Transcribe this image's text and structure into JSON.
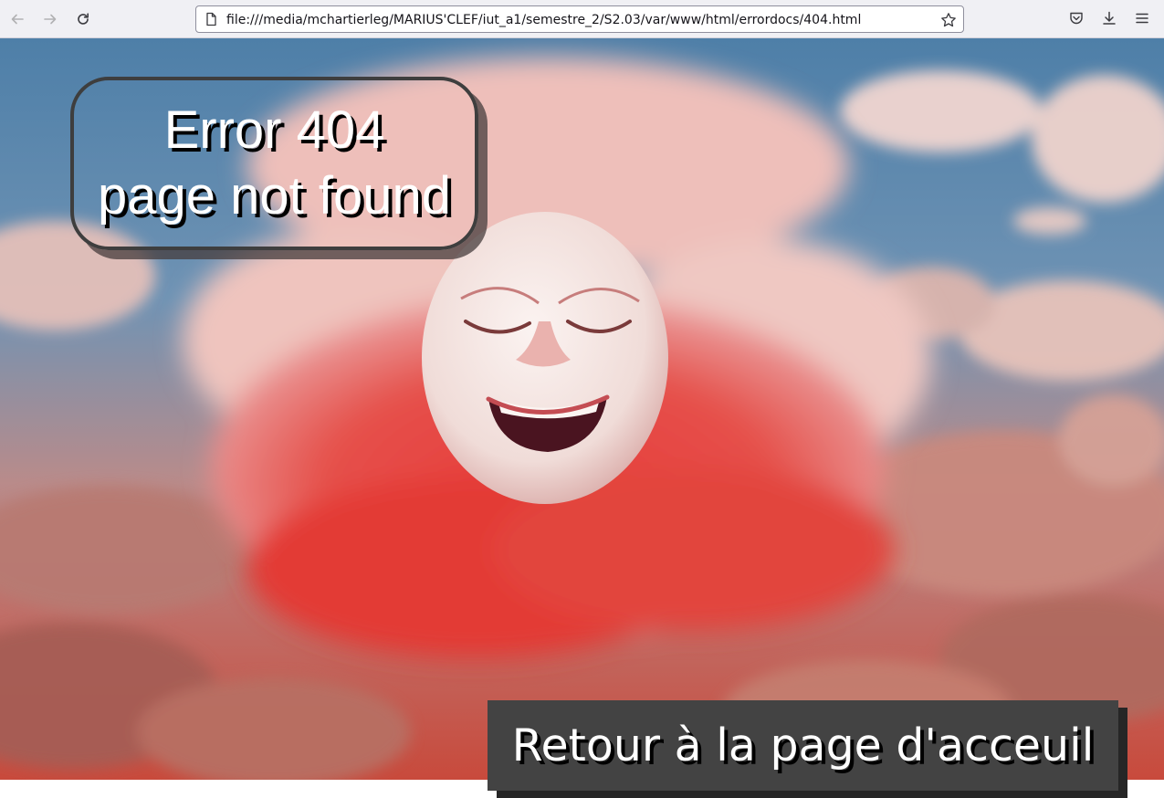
{
  "browser": {
    "url": "file:///media/mchartierleg/MARIUS'CLEF/iut_a1/semestre_2/S2.03/var/www/html/errordocs/404.html",
    "icons": {
      "back": "arrow-left-icon",
      "forward": "arrow-right-icon",
      "reload": "reload-icon",
      "page": "page-icon",
      "bookmark": "star-icon",
      "pocket": "pocket-icon",
      "downloads": "download-icon",
      "menu": "hamburger-menu-icon"
    }
  },
  "page": {
    "error": {
      "line1": "Error 404",
      "line2": "page not found"
    },
    "home_link": {
      "label": "Retour à la page d'acceuil"
    },
    "colors": {
      "box_bg": "#434343",
      "text": "#ffffff",
      "text_shadow": "#000000",
      "chrome_bg": "#f0f0f4"
    }
  }
}
